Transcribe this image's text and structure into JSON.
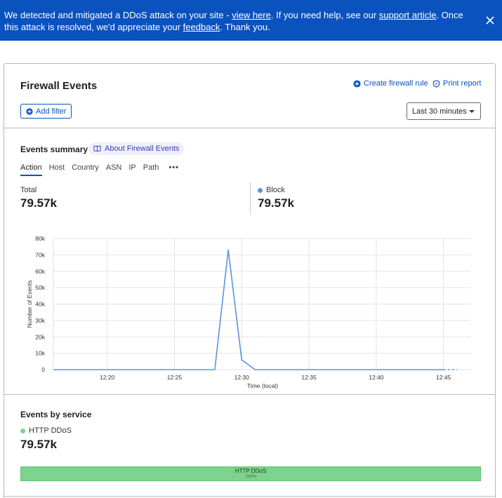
{
  "banner": {
    "text_1": "We detected and mitigated a DDoS attack on your site - ",
    "link_view": "view here",
    "text_2": ". If you need help, see our ",
    "link_support": "support article",
    "text_3": ". Once this attack is resolved, we'd appreciate your ",
    "link_feedback": "feedback",
    "text_4": ". Thank you.",
    "close_icon": "close-icon"
  },
  "header": {
    "title": "Firewall Events",
    "create_rule": "Create firewall rule",
    "print_report": "Print report",
    "add_filter": "Add filter",
    "time_range": "Last 30 minutes"
  },
  "summary": {
    "title": "Events summary",
    "about_link": "About Firewall Events",
    "tabs": [
      "Action",
      "Host",
      "Country",
      "ASN",
      "IP",
      "Path"
    ],
    "more": "•••",
    "total_label": "Total",
    "total_value": "79.57k",
    "block_label": "Block",
    "block_value": "79.57k"
  },
  "colors": {
    "accent": "#0a52be",
    "block_series": "#5b93e0",
    "http_ddos": "#7dd38b"
  },
  "chart_data": {
    "type": "line",
    "title": "",
    "xlabel": "Time (local)",
    "ylabel": "Number of Events",
    "x_ticks": [
      "12:20",
      "12:25",
      "12:30",
      "12:35",
      "12:40",
      "12:45"
    ],
    "y_ticks": [
      "0",
      "10k",
      "20k",
      "30k",
      "40k",
      "50k",
      "60k",
      "70k",
      "80k"
    ],
    "ylim": [
      0,
      80000
    ],
    "xlim_minutes": [
      "12:16",
      "12:47"
    ],
    "grid": true,
    "series": [
      {
        "name": "Block",
        "x": [
          "12:16",
          "12:17",
          "12:18",
          "12:19",
          "12:20",
          "12:21",
          "12:22",
          "12:23",
          "12:24",
          "12:25",
          "12:26",
          "12:27",
          "12:28",
          "12:29",
          "12:30",
          "12:31",
          "12:32",
          "12:33",
          "12:34",
          "12:35",
          "12:36",
          "12:37",
          "12:38",
          "12:39",
          "12:40",
          "12:41",
          "12:42",
          "12:43",
          "12:44",
          "12:45",
          "12:46"
        ],
        "values": [
          0,
          0,
          0,
          0,
          0,
          0,
          0,
          0,
          0,
          0,
          0,
          0,
          0,
          73000,
          6000,
          0,
          0,
          0,
          0,
          0,
          0,
          0,
          0,
          0,
          0,
          0,
          0,
          0,
          0,
          0,
          0
        ]
      }
    ]
  },
  "service": {
    "title": "Events by service",
    "legend_label": "HTTP DDoS",
    "value": "79.57k",
    "bar_label": "HTTP DDoS",
    "bar_percent": "100%",
    "bar_fraction": 1.0
  }
}
